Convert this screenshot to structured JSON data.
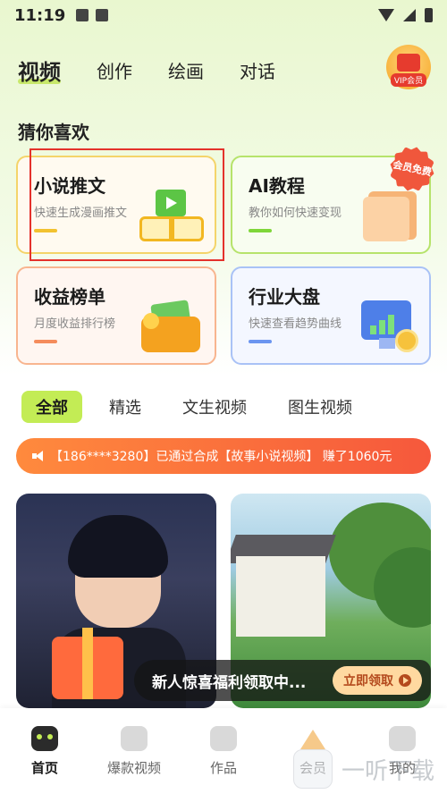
{
  "status_bar": {
    "time": "11:19"
  },
  "top_tabs": [
    {
      "label": "视频",
      "active": true
    },
    {
      "label": "创作",
      "active": false
    },
    {
      "label": "绘画",
      "active": false
    },
    {
      "label": "对话",
      "active": false
    }
  ],
  "vip": {
    "label": "VIP会员"
  },
  "section": {
    "title": "猜你喜欢"
  },
  "cards": [
    {
      "title": "小说推文",
      "subtitle": "快速生成漫画推文",
      "icon": "book-play-icon"
    },
    {
      "title": "AI教程",
      "subtitle": "教你如何快速变现",
      "icon": "folder-icon",
      "badge": "会员免费"
    },
    {
      "title": "收益榜单",
      "subtitle": "月度收益排行榜",
      "icon": "wallet-icon"
    },
    {
      "title": "行业大盘",
      "subtitle": "快速查看趋势曲线",
      "icon": "chart-monitor-icon"
    }
  ],
  "filters": [
    {
      "label": "全部",
      "active": true
    },
    {
      "label": "精选",
      "active": false
    },
    {
      "label": "文生视频",
      "active": false
    },
    {
      "label": "图生视频",
      "active": false
    }
  ],
  "notice": {
    "text": "【186****3280】已通过合成【故事小说视频】 赚了1060元"
  },
  "promo": {
    "text": "新人惊喜福利领取中...",
    "button": "立即领取"
  },
  "bottom_nav": [
    {
      "label": "首页",
      "icon": "robot-icon",
      "active": true
    },
    {
      "label": "爆款视频",
      "icon": "video-icon",
      "active": false
    },
    {
      "label": "作品",
      "icon": "layers-icon",
      "active": false
    },
    {
      "label": "会员",
      "icon": "crown-icon",
      "active": false
    },
    {
      "label": "我的",
      "icon": "profile-icon",
      "active": false
    }
  ],
  "watermark": {
    "text": "一听下载"
  },
  "colors": {
    "accent": "#c3ec55",
    "notice_gradient": [
      "#ff8a3d",
      "#f6583c"
    ],
    "highlight": "#e4322b"
  }
}
